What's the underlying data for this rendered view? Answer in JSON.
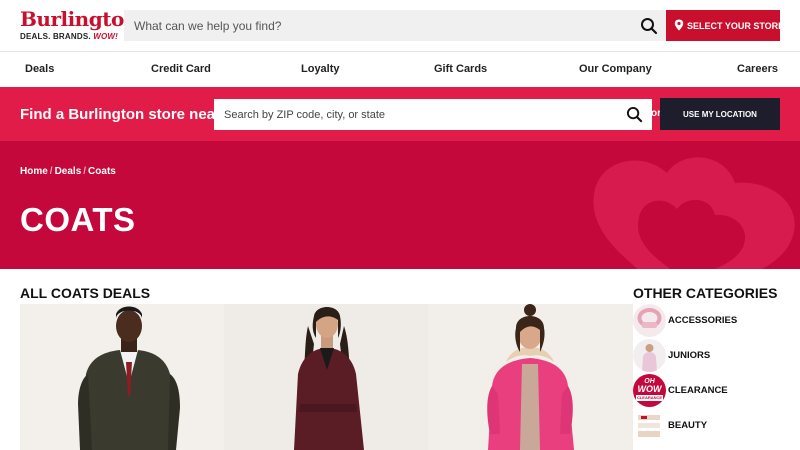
{
  "header": {
    "logo_word": "Burlington",
    "logo_tag_1": "DEALS. BRANDS.",
    "logo_tag_wow": "WOW!",
    "search_placeholder": "What can we help you find?",
    "store_button": "SELECT YOUR STORE"
  },
  "nav": {
    "items": [
      "Deals",
      "Credit Card",
      "Loyalty",
      "Gift Cards",
      "Our Company",
      "Careers"
    ]
  },
  "finder": {
    "title": "Find a Burlington store near you",
    "input_placeholder": "Search by ZIP code, city, or state",
    "or": "or",
    "location_button": "USE MY LOCATION"
  },
  "hero": {
    "breadcrumb": [
      "Home",
      "Deals",
      "Coats"
    ],
    "separator": "/",
    "title": "COATS"
  },
  "main": {
    "section_title": "ALL COATS DEALS"
  },
  "sidebar": {
    "title": "OTHER CATEGORIES",
    "categories": [
      "ACCESSORIES",
      "JUNIORS",
      "CLEARANCE",
      "BEAUTY"
    ],
    "clearance_badge_1": "OH",
    "clearance_badge_2": "WOW",
    "clearance_badge_3": "CLEARANCE"
  },
  "colors": {
    "brand_red": "#c8102e",
    "finder_pink": "#e11c48",
    "hero_crimson": "#c4083c",
    "dark_button": "#1d1d2b"
  }
}
